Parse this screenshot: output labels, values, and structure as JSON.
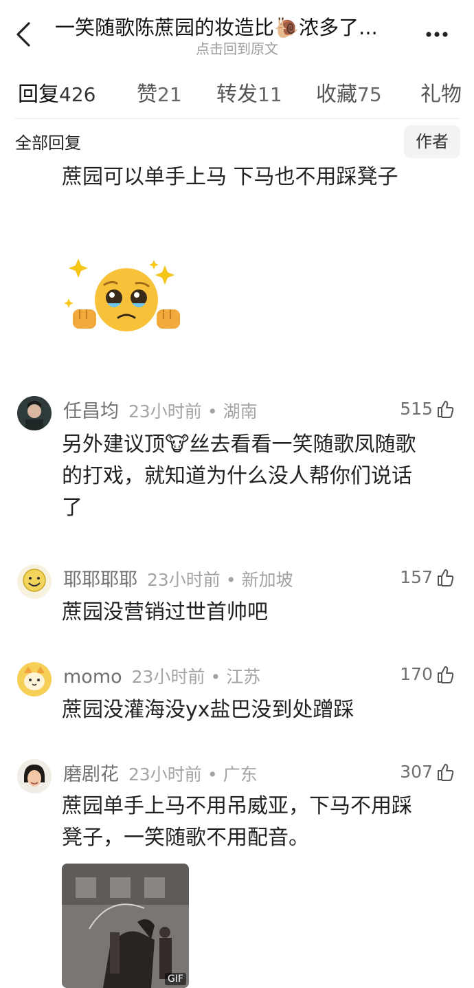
{
  "header": {
    "title": "一笑随歌陈蔗园的妆造比🐌浓多了...",
    "subtitle": "点击回到原文"
  },
  "tabs": [
    {
      "label": "回复",
      "count": "426"
    },
    {
      "label": "赞",
      "count": "21"
    },
    {
      "label": "转发",
      "count": "11"
    },
    {
      "label": "收藏",
      "count": "75"
    },
    {
      "label": "礼物",
      "count": ""
    }
  ],
  "filter": {
    "label": "全部回复",
    "author_button": "作者"
  },
  "previous_comment": {
    "text": "蔗园可以单手上马 下马也不用踩凳子"
  },
  "comments": [
    {
      "user": "任昌均",
      "time": "23小时前",
      "location": "湖南",
      "likes": "515",
      "lines": [
        "另外建议顶🐮丝去看看一笑随歌凤随歌",
        "的打戏，就知道为什么没人帮你们说话",
        "了"
      ]
    },
    {
      "user": "耶耶耶耶",
      "time": "23小时前",
      "location": "新加坡",
      "likes": "157",
      "lines": [
        "蔗园没营销过世首帅吧"
      ]
    },
    {
      "user": "momo",
      "time": "23小时前",
      "location": "江苏",
      "likes": "170",
      "lines": [
        "蔗园没灌海没yx盐巴没到处蹭踩"
      ]
    },
    {
      "user": "磨剧花",
      "time": "23小时前",
      "location": "广东",
      "likes": "307",
      "lines": [
        "蔗园单手上马不用吊威亚，下马不用踩",
        "凳子，一笑随歌不用配音。"
      ],
      "media_badge": "GIF"
    }
  ],
  "colors": {
    "text": "#222222",
    "meta": "#a3a3a3",
    "username": "#707070",
    "background": "#ffffff"
  }
}
